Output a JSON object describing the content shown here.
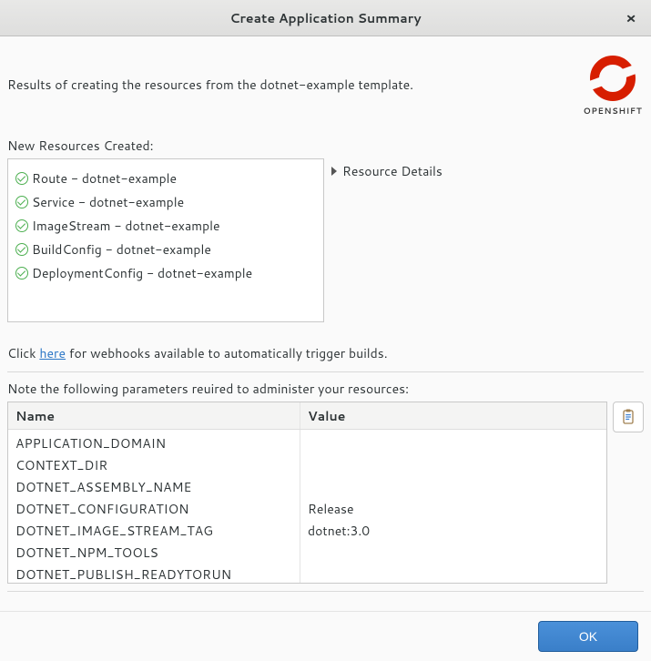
{
  "window": {
    "title": "Create Application Summary",
    "close_symbol": "×"
  },
  "header": {
    "result_text": "Results of creating the resources from the dotnet-example template.",
    "logo_label": "OPENSHIFT"
  },
  "resources": {
    "label": "New Resources Created:",
    "items": [
      {
        "text": "Route - dotnet-example"
      },
      {
        "text": "Service - dotnet-example"
      },
      {
        "text": "ImageStream - dotnet-example"
      },
      {
        "text": "BuildConfig - dotnet-example"
      },
      {
        "text": "DeploymentConfig - dotnet-example"
      }
    ],
    "details_label": "Resource Details"
  },
  "webhook": {
    "prefix": "Click ",
    "link": "here",
    "suffix": " for webhooks available to automatically trigger builds."
  },
  "params": {
    "note": "Note the following parameters reuired to administer your resources:",
    "header_name": "Name",
    "header_value": "Value",
    "rows": [
      {
        "name": "APPLICATION_DOMAIN",
        "value": ""
      },
      {
        "name": "CONTEXT_DIR",
        "value": ""
      },
      {
        "name": "DOTNET_ASSEMBLY_NAME",
        "value": ""
      },
      {
        "name": "DOTNET_CONFIGURATION",
        "value": "Release"
      },
      {
        "name": "DOTNET_IMAGE_STREAM_TAG",
        "value": "dotnet:3.0"
      },
      {
        "name": "DOTNET_NPM_TOOLS",
        "value": ""
      },
      {
        "name": "DOTNET_PUBLISH_READYTORUN",
        "value": ""
      }
    ]
  },
  "footer": {
    "ok_label": "OK"
  }
}
